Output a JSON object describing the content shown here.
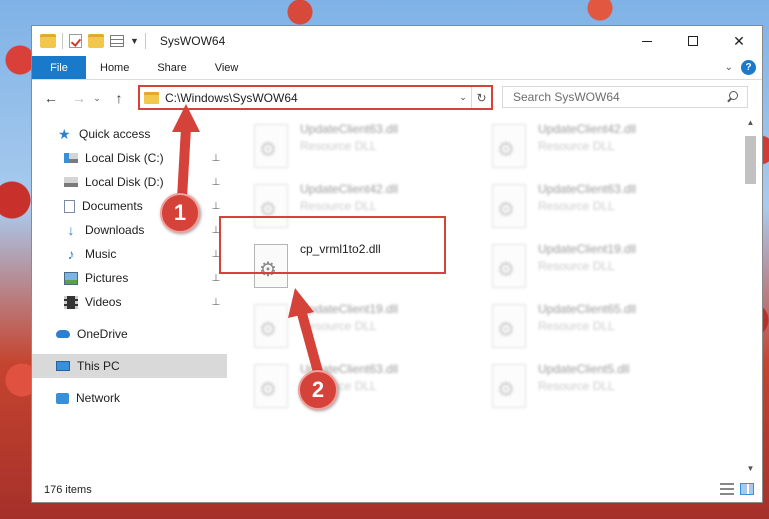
{
  "window": {
    "title": "SysWOW64",
    "controls": {
      "minimize": "",
      "maximize": "",
      "close": "✕"
    }
  },
  "ribbon": {
    "tabs": [
      "File",
      "Home",
      "Share",
      "View"
    ],
    "help": "?"
  },
  "nav": {
    "back": "←",
    "forward": "→",
    "recent": "⌄",
    "up": "↑",
    "address": "C:\\Windows\\SysWOW64",
    "address_dropdown": "⌄",
    "refresh": "↻",
    "search_placeholder": "Search SysWOW64"
  },
  "sidebar": {
    "items": [
      {
        "label": "Quick access",
        "icon": "star-icon"
      },
      {
        "label": "Local Disk (C:)",
        "icon": "drive-icon",
        "pinned": true
      },
      {
        "label": "Local Disk (D:)",
        "icon": "drive-icon",
        "pinned": true
      },
      {
        "label": "Documents",
        "icon": "documents-icon",
        "pinned": true
      },
      {
        "label": "Downloads",
        "icon": "download-icon",
        "pinned": true
      },
      {
        "label": "Music",
        "icon": "music-icon",
        "pinned": true
      },
      {
        "label": "Pictures",
        "icon": "pictures-icon",
        "pinned": true
      },
      {
        "label": "Videos",
        "icon": "video-icon",
        "pinned": true
      },
      {
        "label": "OneDrive",
        "icon": "cloud-icon"
      },
      {
        "label": "This PC",
        "icon": "computer-icon",
        "selected": true
      },
      {
        "label": "Network",
        "icon": "network-icon"
      }
    ],
    "pin_glyph": "📌"
  },
  "files": [
    {
      "name": "UpdateClient63.dll",
      "type": "Resource DLL",
      "blurred": true
    },
    {
      "name": "UpdateClient42.dll",
      "type": "Resource DLL",
      "blurred": true
    },
    {
      "name": "UpdateClient42.dll",
      "type": "Resource DLL",
      "blurred": true
    },
    {
      "name": "UpdateClient63.dll",
      "type": "Resource DLL",
      "blurred": true
    },
    {
      "name": "cp_vrml1to2.dll",
      "type": "",
      "blurred": false
    },
    {
      "name": "UpdateClient19.dll",
      "type": "Resource DLL",
      "blurred": true
    },
    {
      "name": "UpdateClient19.dll",
      "type": "Resource DLL",
      "blurred": true
    },
    {
      "name": "UpdateClient65.dll",
      "type": "Resource DLL",
      "blurred": true
    },
    {
      "name": "UpdateClient63.dll",
      "type": "Resource DLL",
      "blurred": true
    },
    {
      "name": "UpdateClient5.dll",
      "type": "Resource DLL",
      "blurred": true
    }
  ],
  "status": {
    "items": "176 items"
  },
  "callouts": {
    "one": "1",
    "two": "2"
  },
  "colors": {
    "accent": "#1979ca",
    "callout": "#d5423a",
    "selected": "#d9d9d9"
  }
}
